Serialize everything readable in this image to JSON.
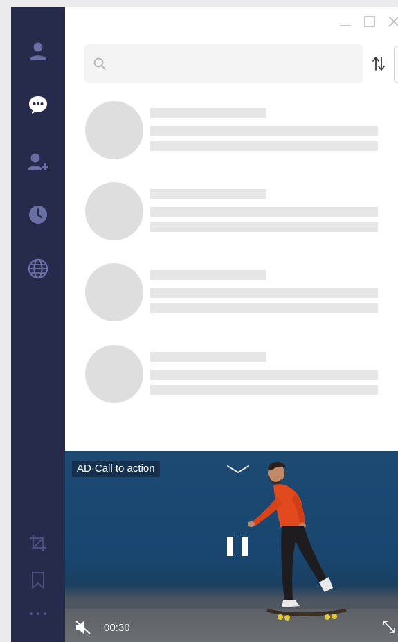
{
  "sidebar": {
    "items": [
      {
        "name": "contacts",
        "icon": "user-icon"
      },
      {
        "name": "chats",
        "icon": "chat-bubble-icon",
        "active": true
      },
      {
        "name": "add-contact",
        "icon": "add-user-icon"
      },
      {
        "name": "recent",
        "icon": "clock-icon"
      },
      {
        "name": "discover",
        "icon": "globe-icon"
      }
    ],
    "bottom_items": [
      {
        "name": "crop",
        "icon": "crop-icon"
      },
      {
        "name": "saved",
        "icon": "bookmark-icon"
      },
      {
        "name": "more",
        "icon": "more-dots-icon"
      }
    ],
    "colors": {
      "background": "#262a4b",
      "icon": "#6a6fa3",
      "icon_active": "#ffffff",
      "icon_muted": "#4b5080"
    }
  },
  "window": {
    "controls": [
      "minimize-icon",
      "maximize-icon",
      "close-icon"
    ]
  },
  "search": {
    "placeholder": "",
    "value": ""
  },
  "chat_list": {
    "loading": true,
    "placeholder_count": 4
  },
  "ad": {
    "label": "AD·Call to action",
    "time": "00:30",
    "muted": true,
    "playing": true
  }
}
